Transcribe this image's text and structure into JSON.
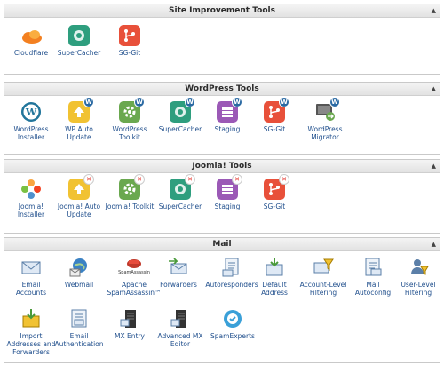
{
  "sections": {
    "site_improvement": {
      "title": "Site Improvement Tools",
      "tools": [
        "Cloudflare",
        "SuperCacher",
        "SG-Git"
      ]
    },
    "wordpress": {
      "title": "WordPress Tools",
      "tools": [
        "WordPress Installer",
        "WP Auto Update",
        "WordPress Toolkit",
        "SuperCacher",
        "Staging",
        "SG-Git",
        "WordPress Migrator"
      ]
    },
    "joomla": {
      "title": "Joomla! Tools",
      "tools": [
        "Joomla! Installer",
        "Joomla! Auto Update",
        "Joomla! Toolkit",
        "SuperCacher",
        "Staging",
        "SG-Git"
      ]
    },
    "mail": {
      "title": "Mail",
      "tools": [
        "Email Accounts",
        "Webmail",
        "Apache SpamAssassin™",
        "Forwarders",
        "Autoresponders",
        "Default Address",
        "Account-Level Filtering",
        "Mail Autoconfig",
        "User-Level Filtering",
        "Import Addresses and Forwarders",
        "Email Authentication",
        "MX Entry",
        "Advanced MX Editor",
        "SpamExperts"
      ],
      "spamassassin_logo_text": "SpamAssassin"
    }
  },
  "collapse_glyph": "▲",
  "badges": {
    "wordpress": "W",
    "joomla": "✕"
  },
  "colors": {
    "supercacher": "#2e9e7e",
    "sg_git": "#e8503a",
    "staging": "#9b59b6",
    "toolkit": "#6aa84f",
    "auto_update": "#f1c232",
    "cloudflare": "#f38020"
  }
}
